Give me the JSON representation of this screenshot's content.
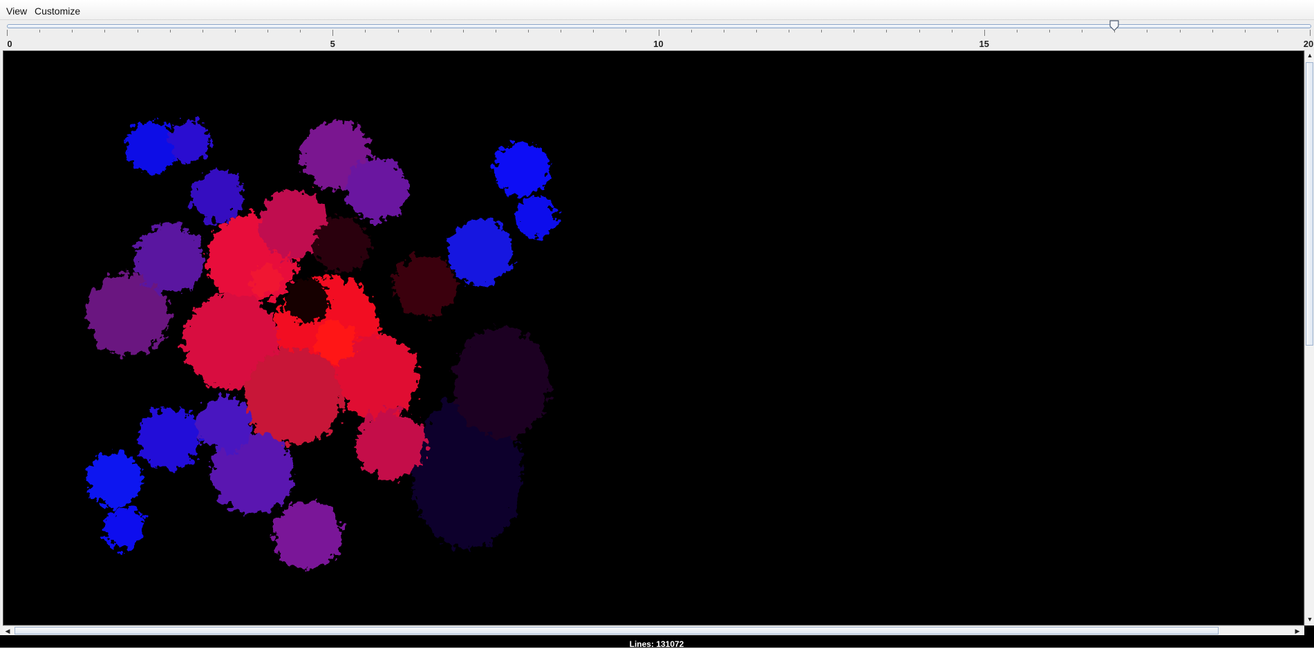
{
  "menu": {
    "items": [
      {
        "label": "View"
      },
      {
        "label": "Customize"
      }
    ]
  },
  "slider": {
    "min": 0,
    "max": 20,
    "value": 17,
    "major_labels": [
      "0",
      "5",
      "10",
      "15",
      "20"
    ]
  },
  "canvas": {
    "background_color": "#000000",
    "fractal": "dragon-curve",
    "colors": {
      "blue": "#0a10f0",
      "purple": "#7a147e",
      "red": "#f01020",
      "dark_red": "#3a0008",
      "dark_blue": "#05052a"
    }
  },
  "status": {
    "text": "Lines: 131072"
  }
}
